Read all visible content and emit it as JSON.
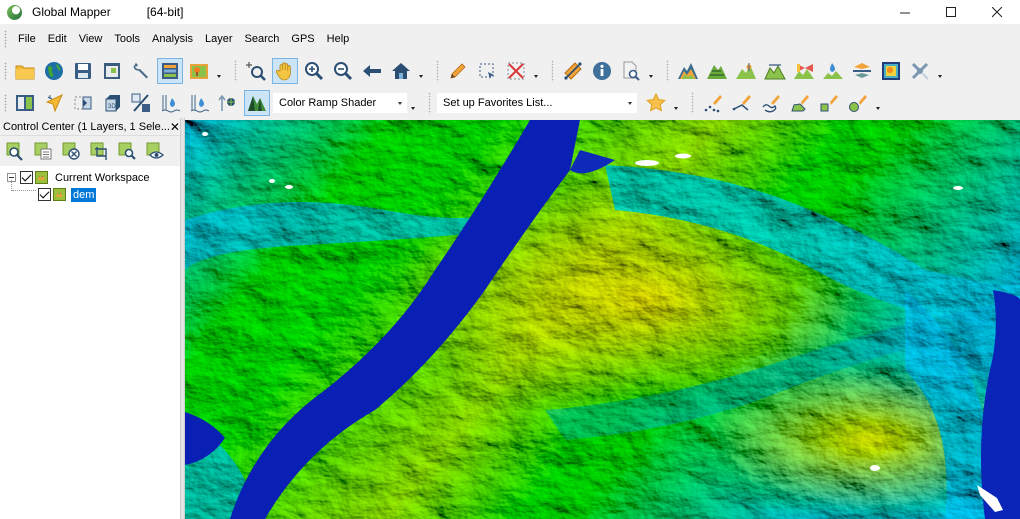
{
  "window": {
    "app_title": "Global Mapper",
    "build": "[64-bit]",
    "controls": {
      "minimize": "minimize",
      "maximize": "maximize",
      "close": "close"
    }
  },
  "menu": {
    "items": [
      "File",
      "Edit",
      "View",
      "Tools",
      "Analysis",
      "Layer",
      "Search",
      "GPS",
      "Help"
    ]
  },
  "toolbar_main": {
    "buttons": [
      {
        "icon": "open-folder-icon",
        "label": "Open Data Files"
      },
      {
        "icon": "globe-icon",
        "label": "Download Online Imagery"
      },
      {
        "icon": "save-icon",
        "label": "Save Workspace"
      },
      {
        "icon": "map-layout-icon",
        "label": "Map Layout"
      },
      {
        "icon": "wrench-icon",
        "label": "Configuration"
      },
      {
        "icon": "control-center-icon",
        "label": "Control Center",
        "active": true
      },
      {
        "icon": "overlay-icon",
        "label": "Overlay Control"
      },
      {
        "icon": "zoom-box-icon",
        "label": "Zoom Tool"
      },
      {
        "icon": "pan-hand-icon",
        "label": "Pan (Grab) Tool",
        "active": true
      },
      {
        "icon": "zoom-in-icon",
        "label": "Zoom In"
      },
      {
        "icon": "zoom-out-icon",
        "label": "Zoom Out"
      },
      {
        "icon": "back-arrow-icon",
        "label": "Previous View"
      },
      {
        "icon": "home-icon",
        "label": "Full View"
      },
      {
        "icon": "pencil-icon",
        "label": "Digitizer Tool"
      },
      {
        "icon": "select-box-icon",
        "label": "Select Features"
      },
      {
        "icon": "delete-x-icon",
        "label": "Delete Features"
      },
      {
        "icon": "measure-ruler-icon",
        "label": "Measure Tool"
      },
      {
        "icon": "info-icon",
        "label": "Feature Info Tool"
      },
      {
        "icon": "search-doc-icon",
        "label": "Search"
      },
      {
        "icon": "terrain-shade-icon",
        "label": "Shaded Terrain"
      },
      {
        "icon": "terrain-contour-icon",
        "label": "Generate Contours"
      },
      {
        "icon": "terrain-peak-icon",
        "label": "Peak Analysis"
      },
      {
        "icon": "terrain-profile-icon",
        "label": "Path Profile"
      },
      {
        "icon": "view-shed-icon",
        "label": "View Shed"
      },
      {
        "icon": "water-drop-terrain-icon",
        "label": "Watershed"
      },
      {
        "icon": "layers-slice-icon",
        "label": "Cut and Fill"
      },
      {
        "icon": "density-grid-icon",
        "label": "Density Grid"
      },
      {
        "icon": "satellite-icon",
        "label": "Satellite Tool"
      }
    ]
  },
  "toolbar_secondary": {
    "buttons": [
      {
        "icon": "split-panel-icon",
        "label": "Split View"
      },
      {
        "icon": "3d-pointer-icon",
        "label": "3D Path"
      },
      {
        "icon": "slice-view-icon",
        "label": "Path Slice"
      },
      {
        "icon": "3d-cube-icon",
        "label": "3D View"
      },
      {
        "icon": "percent-transparency-icon",
        "label": "Transparency"
      },
      {
        "icon": "water-level-up-icon",
        "label": "Water Level Up"
      },
      {
        "icon": "water-level-down-icon",
        "label": "Water Level Down"
      },
      {
        "icon": "vertical-exaggeration-icon",
        "label": "Vertical Exaggeration"
      },
      {
        "icon": "hillshade-icon",
        "label": "Enable Hill Shading",
        "active": true
      }
    ],
    "shader_select": {
      "value": "Color Ramp Shader"
    },
    "favorites_select": {
      "value": "Set up Favorites List..."
    },
    "digitize_buttons": [
      {
        "icon": "star-icon",
        "label": "Favorites"
      },
      {
        "icon": "digitize-points-icon",
        "label": "Create Points"
      },
      {
        "icon": "digitize-line-icon",
        "label": "Create Line"
      },
      {
        "icon": "digitize-trace-icon",
        "label": "Trace Line"
      },
      {
        "icon": "digitize-area-icon",
        "label": "Create Area"
      },
      {
        "icon": "digitize-rect-icon",
        "label": "Create Rectangle"
      },
      {
        "icon": "digitize-circle-icon",
        "label": "Create Circle"
      }
    ]
  },
  "control_center": {
    "title": "Control Center (1 Layers, 1 Sele...",
    "close": "✕",
    "tools": [
      {
        "icon": "layer-zoom-icon"
      },
      {
        "icon": "layer-metadata-icon"
      },
      {
        "icon": "layer-close-icon"
      },
      {
        "icon": "layer-crop-icon"
      },
      {
        "icon": "layer-search-icon"
      },
      {
        "icon": "layer-visibility-icon"
      }
    ],
    "tree": {
      "workspace": {
        "label": "Current Workspace",
        "checked": true,
        "expanded": true
      },
      "layers": [
        {
          "label": "dem",
          "checked": true,
          "selected": true
        }
      ]
    }
  },
  "map": {
    "layer": "dem",
    "shader": "Color Ramp Shader",
    "colors": {
      "low": "#0a1fb4",
      "mid_low": "#1fc8d8",
      "mid": "#22d11e",
      "high": "#a8d61c",
      "peak": "#e0c020",
      "shadow": "#050a08"
    }
  }
}
